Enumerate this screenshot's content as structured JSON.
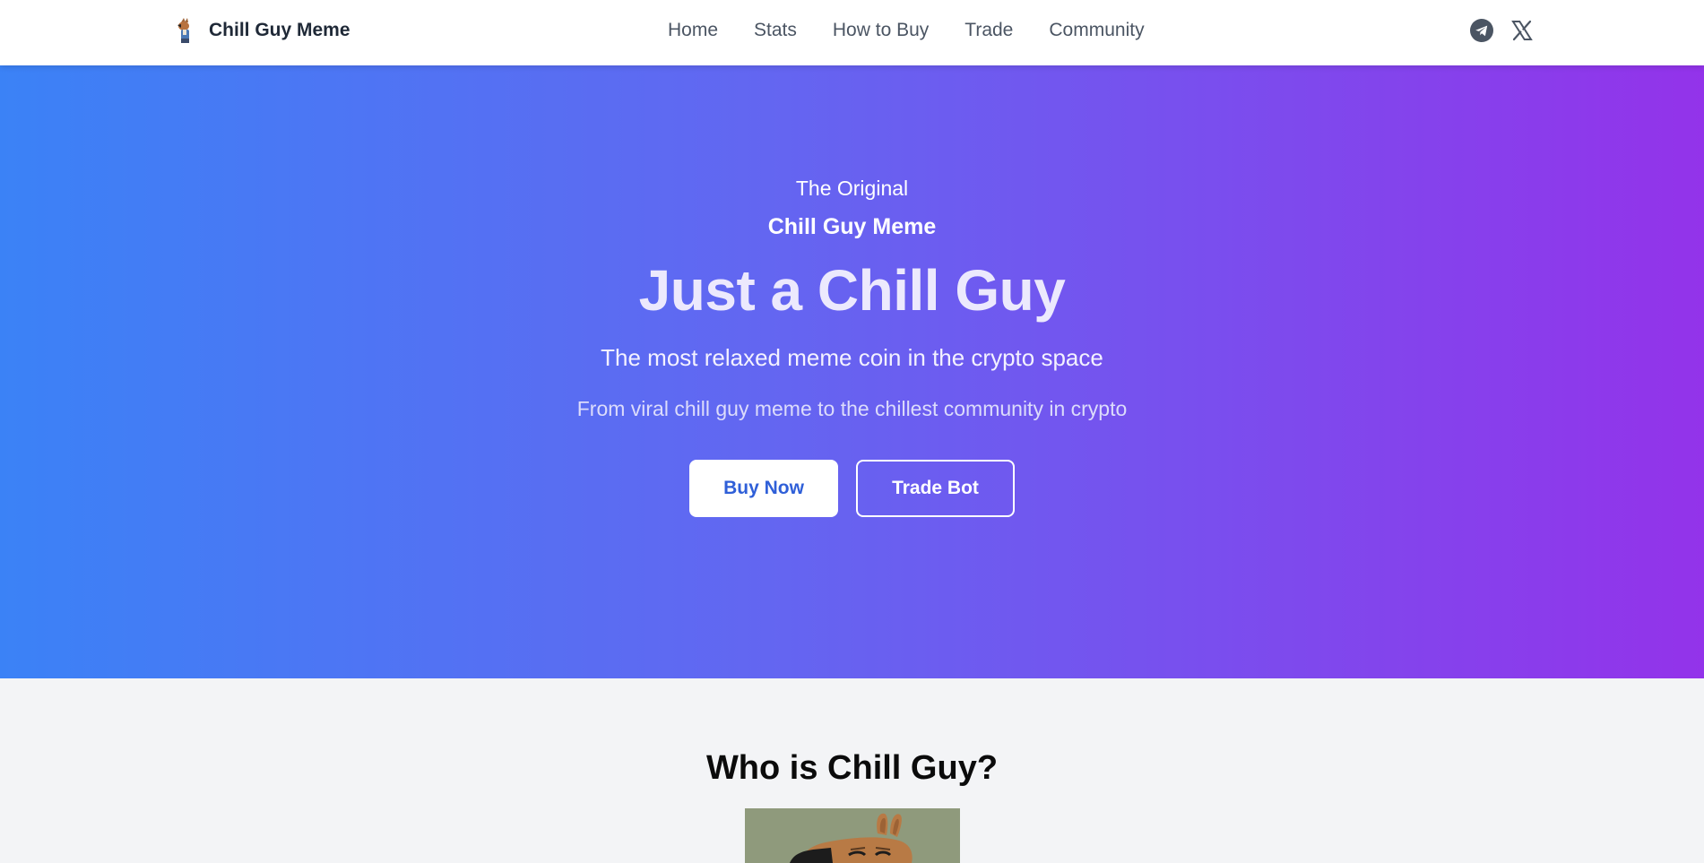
{
  "brand": {
    "name": "Chill Guy Meme",
    "logo_icon": "chill-guy-logo-icon"
  },
  "nav": {
    "links": [
      "Home",
      "Stats",
      "How to Buy",
      "Trade",
      "Community"
    ]
  },
  "socials": {
    "items": [
      {
        "icon": "telegram-icon"
      },
      {
        "icon": "x-icon"
      }
    ]
  },
  "hero": {
    "tagline": "The Original",
    "name": "Chill Guy Meme",
    "title": "Just a Chill Guy",
    "subtitle": "The most relaxed meme coin in the crypto space",
    "description": "From viral chill guy meme to the chillest community in crypto",
    "buy_label": "Buy Now",
    "trade_label": "Trade Bot",
    "gradient": [
      "#3b82f6",
      "#6366f1",
      "#9333ea"
    ]
  },
  "who": {
    "title": "Who is Chill Guy?"
  },
  "colors": {
    "nav_text": "#4b5563",
    "brand_text": "#1f2937",
    "buy_text": "#2f5fd8",
    "page_bg": "#f3f4f6"
  }
}
